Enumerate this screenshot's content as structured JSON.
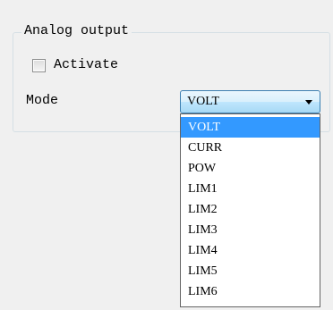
{
  "group": {
    "title": "Analog output"
  },
  "activate": {
    "label": "Activate",
    "checked": false
  },
  "mode": {
    "label": "Mode",
    "selected": "VOLT",
    "options": [
      "VOLT",
      "CURR",
      "POW",
      "LIM1",
      "LIM2",
      "LIM3",
      "LIM4",
      "LIM5",
      "LIM6"
    ]
  },
  "colors": {
    "highlight": "#3399ff",
    "select_border": "#3c7fb1"
  },
  "icons": {
    "dropdown_arrow": "chevron-down-icon"
  }
}
